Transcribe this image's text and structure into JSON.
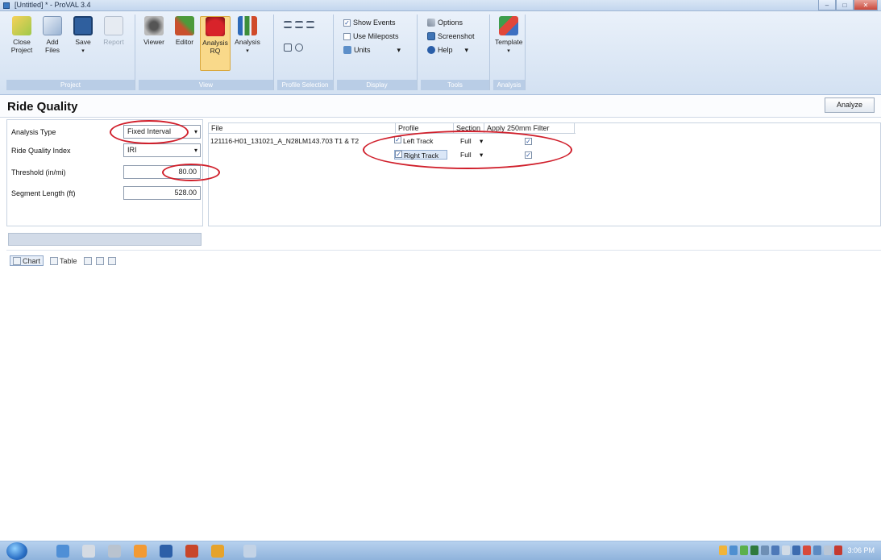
{
  "window": {
    "title": "[Untitled] * - ProVAL 3.4",
    "controls": {
      "minimize": "–",
      "maximize": "□",
      "close": "✕"
    }
  },
  "ribbon": {
    "groups": {
      "project": "Project",
      "view": "View",
      "profile_selection": "Profile Selection",
      "display": "Display",
      "tools": "Tools",
      "analysis": "Analysis"
    },
    "buttons": {
      "close_project": "Close Project",
      "add_files": "Add Files",
      "save": "Save",
      "report": "Report",
      "viewer": "Viewer",
      "editor": "Editor",
      "analysis_rq": "Analysis RQ",
      "analysis": "Analysis",
      "template": "Template"
    },
    "display": {
      "show_events": "Show Events",
      "use_mileposts": "Use Mileposts",
      "units": "Units"
    },
    "tools": {
      "options": "Options",
      "screenshot": "Screenshot",
      "help": "Help"
    },
    "dropdown_marker": "▾"
  },
  "page": {
    "title": "Ride Quality",
    "analyze_label": "Analyze"
  },
  "params": {
    "analysis_type_label": "Analysis Type",
    "analysis_type_value": "Fixed Interval",
    "rqi_label": "Ride Quality Index",
    "rqi_value": "IRI",
    "threshold_label": "Threshold (in/mi)",
    "threshold_value": "80.00",
    "segment_length_label": "Segment Length (ft)",
    "segment_length_value": "528.00"
  },
  "files_table": {
    "headers": {
      "file": "File",
      "profile": "Profile",
      "section": "Section",
      "filter": "Apply 250mm Filter"
    },
    "file_name": "121116-H01_131021_A_N28LM143.703 T1 & T2",
    "rows": [
      {
        "profile": "Left Track",
        "section": "Full",
        "filter": "✓",
        "checked": "✓"
      },
      {
        "profile": "Right Track",
        "section": "Full",
        "filter": "✓",
        "checked": "✓"
      }
    ]
  },
  "view_tabs": {
    "chart": "Chart",
    "table": "Table"
  },
  "taskbar": {
    "clock": "3:06 PM"
  }
}
